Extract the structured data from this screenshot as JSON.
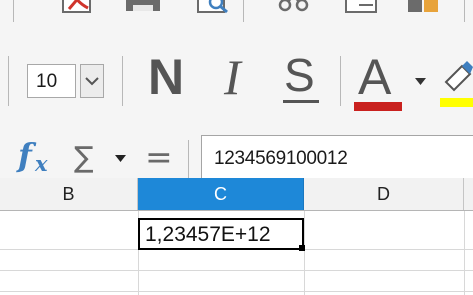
{
  "toolbar": {
    "font_size": "10",
    "bold_label": "N",
    "italic_label": "I",
    "strikethrough_label": "S",
    "font_color_label": "A",
    "font_color": "#c9211e",
    "highlight_color": "#ffff00"
  },
  "formula_bar": {
    "function_wizard_icon": "fx-icon",
    "sum_icon": "sigma-icon",
    "sum_symbol": "∑",
    "equals_symbol": "=",
    "input_value": "1234569100012"
  },
  "sheet": {
    "columns": [
      "B",
      "C",
      "D"
    ],
    "selected_column": "C",
    "active_cell_value": "1,23457E+12",
    "selection_color": "#1e88d8"
  }
}
